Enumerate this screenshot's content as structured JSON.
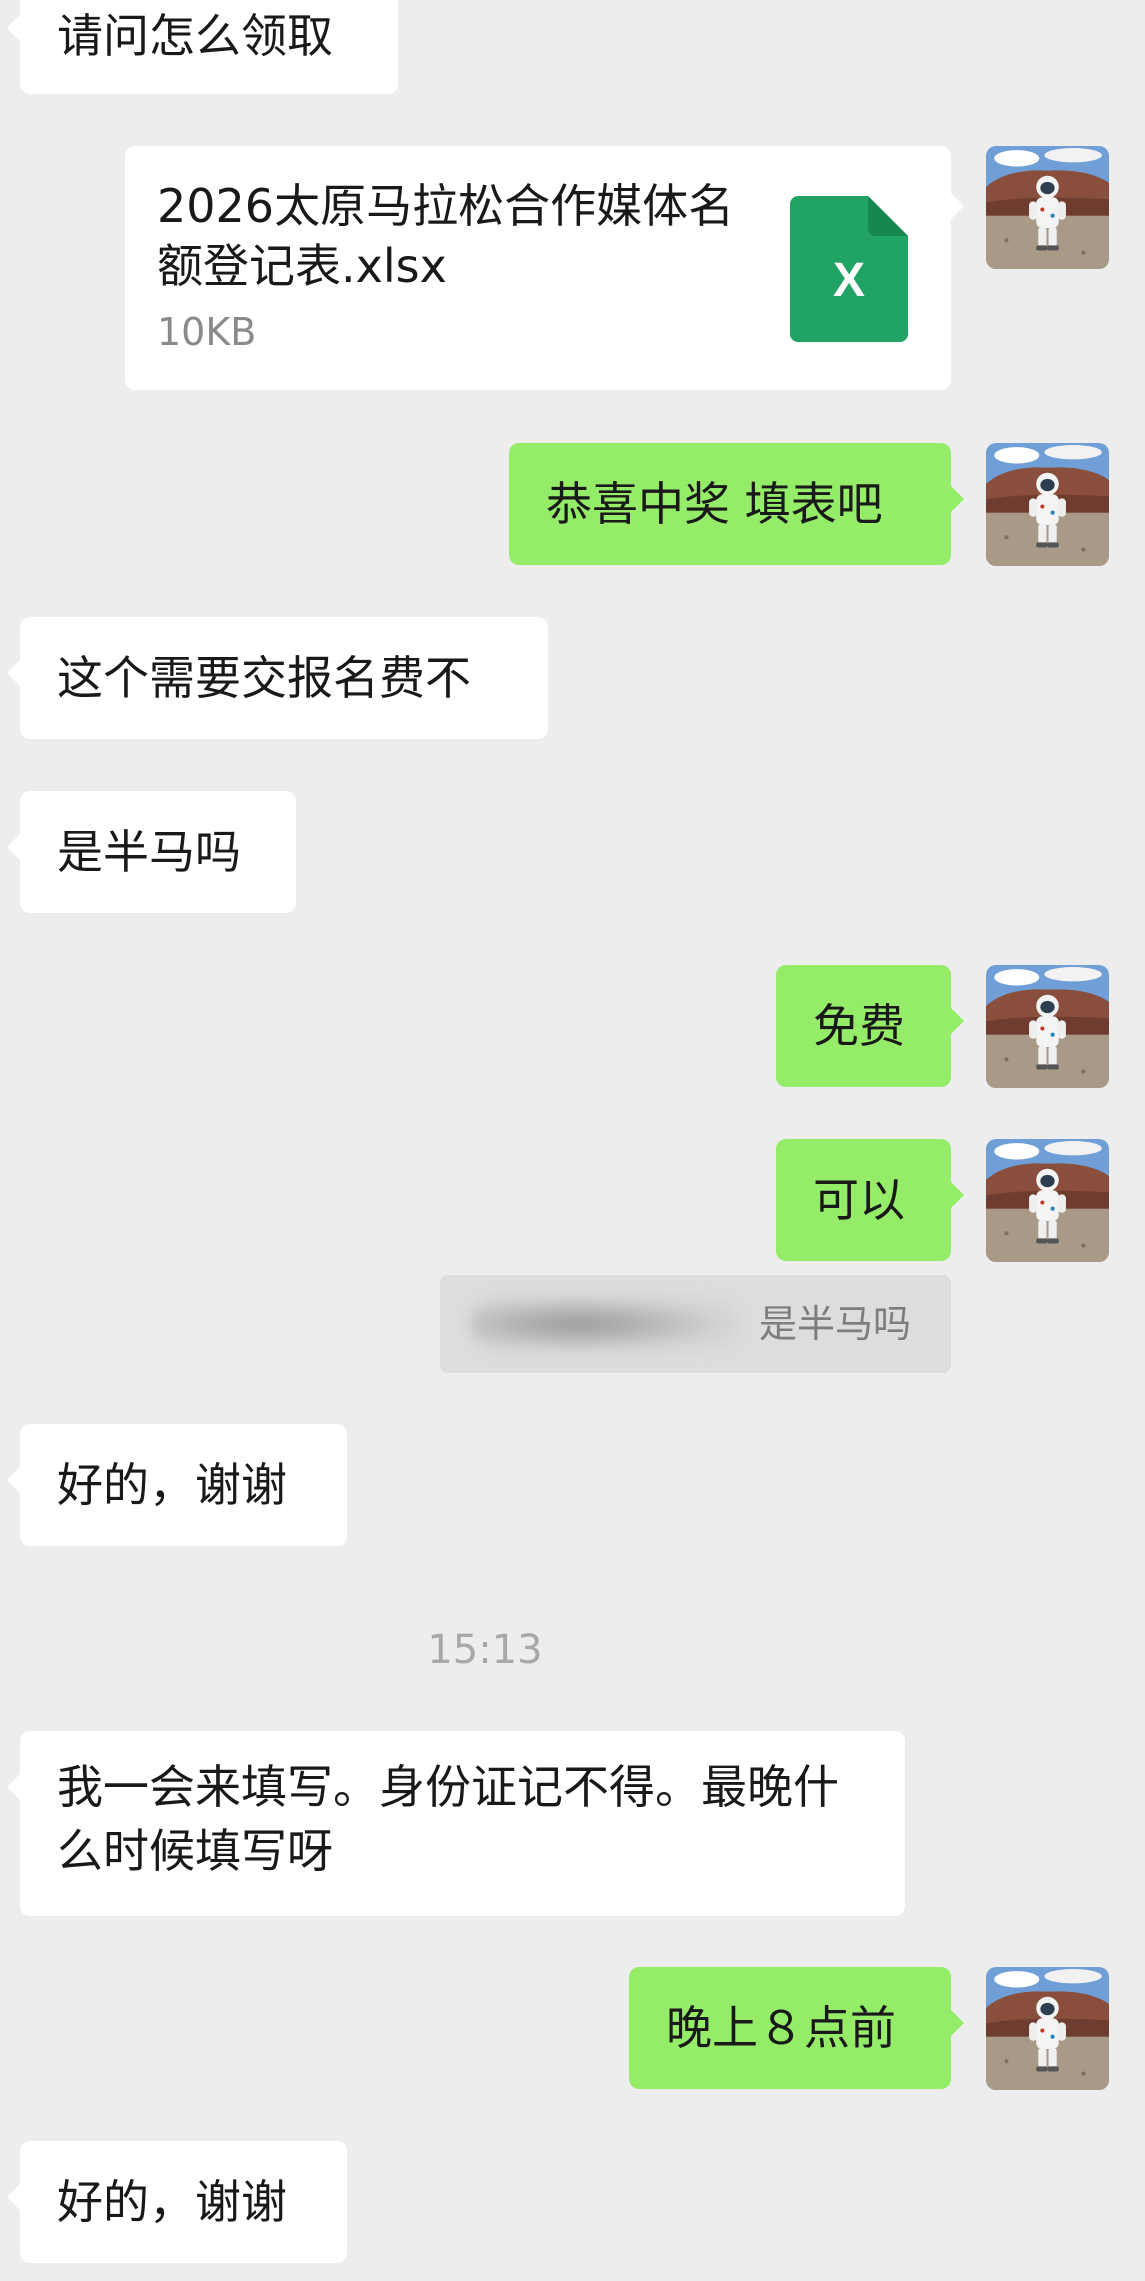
{
  "messages": {
    "m1": "请问怎么领取",
    "file": {
      "name": "2026太原马拉松合作媒体名额登记表.xlsx",
      "size": "10KB",
      "icon_label": "X"
    },
    "m3": "恭喜中奖 填表吧",
    "m4": "这个需要交报名费不",
    "m5": "是半马吗",
    "m6": "免费",
    "m7": "可以",
    "quote": "是半马吗",
    "m8": "好的，谢谢",
    "timestamp": "15:13",
    "m9": "我一会来填写。身份证记不得。最晚什么时候填写呀",
    "m10": "晚上８点前",
    "m11": "好的，谢谢"
  },
  "colors": {
    "background": "#ededed",
    "incoming": "#ffffff",
    "outgoing": "#95ec69",
    "excel": "#21a366"
  },
  "avatar_icon": "astronaut-avatar"
}
